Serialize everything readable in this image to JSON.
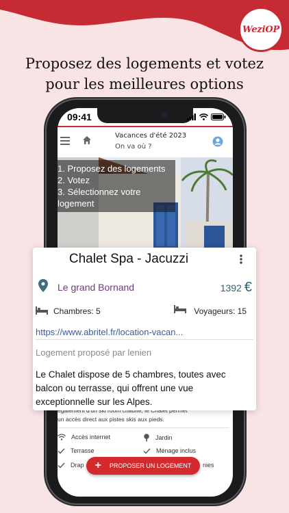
{
  "brand": {
    "logo_text": "WeziOP",
    "accent_color": "#c62a32",
    "background_color": "#f8e3e5"
  },
  "headline": {
    "line1": "Proposez des logements et votez",
    "line2": "pour les meilleures options"
  },
  "status_bar": {
    "time": "09:41"
  },
  "app_bar": {
    "title": "Vacances d'été 2023",
    "subtitle": "On va où ?"
  },
  "steps": [
    "1. Proposez des logements",
    "2. Votez",
    "3. Sélectionnez votre logement"
  ],
  "card": {
    "title": "Chalet Spa - Jacuzzi",
    "location": "Le grand Bornand",
    "price": "1392",
    "currency": "€",
    "rooms": "Chambres: 5",
    "guests": "Voyageurs: 15",
    "link": "https://www.abritel.fr/location-vacan...",
    "proposed_by": "Logement proposé par lenien",
    "description": "Le Chalet dispose de 5 chambres, toutes avec balcon ou terrasse, qui offrent une vue exceptionnelle sur les Alpes."
  },
  "description_continued": {
    "line1": "également d'un ski room chauffé, le Chalet permet",
    "line2": "un accès direct aux pistes skis aux pieds."
  },
  "amenities": [
    {
      "label": "Accès internet",
      "icon": "wifi-icon"
    },
    {
      "label": "Jardin",
      "icon": "tree-icon"
    },
    {
      "label": "Terrasse",
      "icon": "check-icon"
    },
    {
      "label": "Ménage inclus",
      "icon": "check-icon"
    },
    {
      "label": "Drap",
      "icon": "check-icon"
    },
    {
      "label": "nies",
      "icon": "check-icon"
    }
  ],
  "fab": {
    "label": "PROPOSER UN LOGEMENT",
    "icon": "plus-icon"
  }
}
